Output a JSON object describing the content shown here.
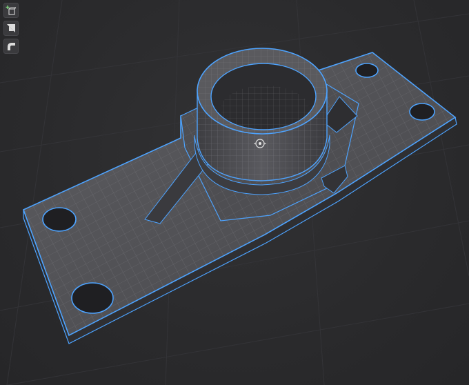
{
  "viewport": {
    "background": "#2b2b2d",
    "wire_color": "#4da3ff",
    "surface_color": "#5a5a5e",
    "grid_color": "#35353a"
  },
  "toolbar": {
    "items": [
      {
        "name": "add-object-button",
        "icon": "add-cube-icon"
      },
      {
        "name": "shading-mode-button",
        "icon": "shading-icon"
      },
      {
        "name": "curve-tool-button",
        "icon": "curve-icon"
      }
    ]
  }
}
